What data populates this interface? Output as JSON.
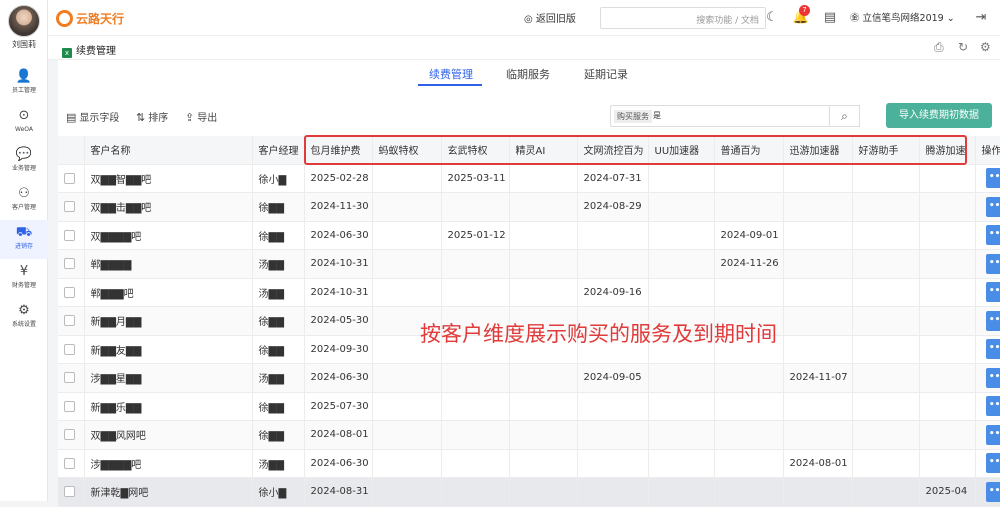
{
  "user": {
    "name": "刘国莉"
  },
  "sidebar": {
    "items": [
      {
        "label": "员工管理",
        "icon": "person-icon"
      },
      {
        "label": "WeOA",
        "icon": "weoa-icon"
      },
      {
        "label": "业务管理",
        "icon": "chat-icon"
      },
      {
        "label": "客户管理",
        "icon": "group-icon"
      },
      {
        "label": "进销存",
        "icon": "truck-icon"
      },
      {
        "label": "财务管理",
        "icon": "money-icon"
      },
      {
        "label": "系统设置",
        "icon": "gear-icon"
      }
    ]
  },
  "topbar": {
    "logo_text": "云路天行",
    "old_version": "返回旧版",
    "search_placeholder": "搜索功能 / 文档",
    "notification_count": "7",
    "company": "立信笔鸟网络2019"
  },
  "page": {
    "doc_tab": "续费管理"
  },
  "tabs": [
    "续费管理",
    "临期服务",
    "延期记录"
  ],
  "toolbar": {
    "show_fields": "显示字段",
    "sort": "排序",
    "export": "导出",
    "filter_tag": "购买服务",
    "filter_value": "是",
    "import_button": "导入续费期初数据"
  },
  "table": {
    "columns": [
      "客户名称",
      "客户经理",
      "包月维护费",
      "蚂蚁特权",
      "玄武特权",
      "精灵AI",
      "文网流控百为",
      "UU加速器",
      "普通百为",
      "迅游加速器",
      "好游助手",
      "腾游加速",
      "操作"
    ],
    "rows": [
      [
        "双▇▇智▇▇吧",
        "徐小▇",
        "2025-02-28",
        "",
        "2025-03-11",
        "",
        "2024-07-31",
        "",
        "",
        "",
        "",
        ""
      ],
      [
        "双▇▇击▇▇吧",
        "徐▇▇",
        "2024-11-30",
        "",
        "",
        "",
        "2024-08-29",
        "",
        "",
        "",
        "",
        ""
      ],
      [
        "双▇▇▇▇吧",
        "徐▇▇",
        "2024-06-30",
        "",
        "2025-01-12",
        "",
        "",
        "",
        "2024-09-01",
        "",
        "",
        ""
      ],
      [
        "郸▇▇▇▇",
        "汤▇▇",
        "2024-10-31",
        "",
        "",
        "",
        "",
        "",
        "2024-11-26",
        "",
        "",
        ""
      ],
      [
        "郸▇▇▇吧",
        "汤▇▇",
        "2024-10-31",
        "",
        "",
        "",
        "2024-09-16",
        "",
        "",
        "",
        "",
        ""
      ],
      [
        "新▇▇月▇▇",
        "徐▇▇",
        "2024-05-30",
        "",
        "",
        "",
        "",
        "",
        "",
        "",
        "",
        ""
      ],
      [
        "新▇▇友▇▇",
        "徐▇▇",
        "2024-09-30",
        "",
        "",
        "",
        "",
        "",
        "",
        "",
        "",
        ""
      ],
      [
        "涉▇▇星▇▇",
        "汤▇▇",
        "2024-06-30",
        "",
        "",
        "",
        "2024-09-05",
        "",
        "",
        "2024-11-07",
        "",
        ""
      ],
      [
        "新▇▇乐▇▇",
        "徐▇▇",
        "2025-07-30",
        "",
        "",
        "",
        "",
        "",
        "",
        "",
        "",
        ""
      ],
      [
        "双▇▇风网吧",
        "徐▇▇",
        "2024-08-01",
        "",
        "",
        "",
        "",
        "",
        "",
        "",
        "",
        ""
      ],
      [
        "涉▇▇▇▇吧",
        "汤▇▇",
        "2024-06-30",
        "",
        "",
        "",
        "",
        "",
        "",
        "2024-08-01",
        "",
        ""
      ],
      [
        "新津乾▇网吧",
        "徐小▇",
        "2024-08-31",
        "",
        "",
        "",
        "",
        "",
        "",
        "",
        "",
        "2025-04"
      ]
    ],
    "action_label": "•••"
  },
  "annotation": "按客户维度展示购买的服务及到期时间",
  "colors": {
    "accent": "#2f62e8",
    "highlight": "#e03a3a",
    "import_button": "#4bb19a",
    "action_button": "#4a8de6"
  }
}
